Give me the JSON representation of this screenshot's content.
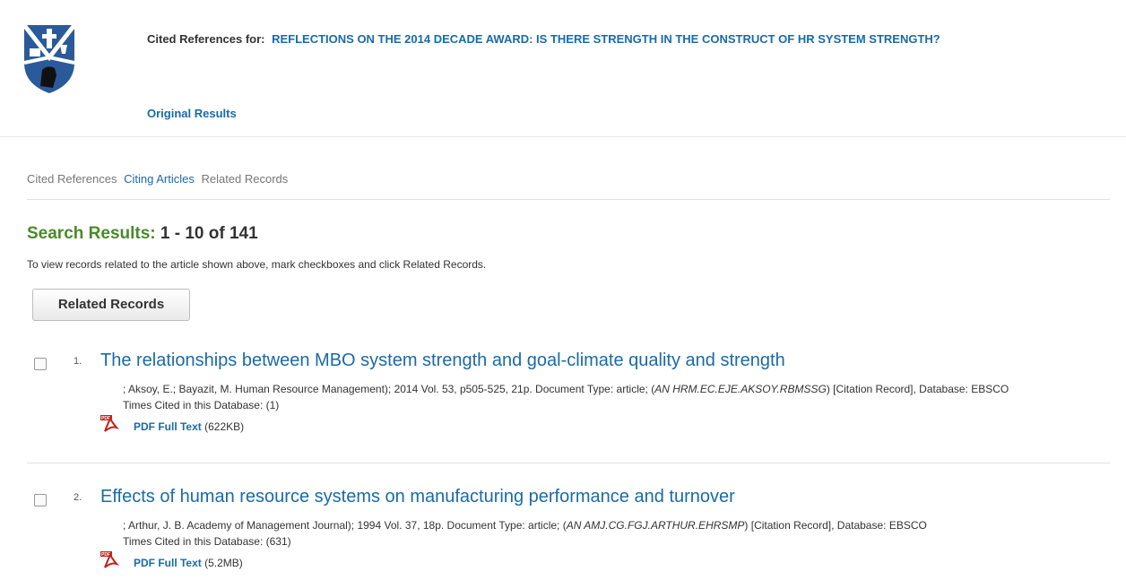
{
  "header": {
    "cited_prefix": "Cited References for:",
    "article_title": "REFLECTIONS ON THE 2014 DECADE AWARD: IS THERE STRENGTH IN THE CONSTRUCT OF HR SYSTEM STRENGTH?",
    "original_results": "Original Results",
    "logo_icon": "university-shield-logo-icon"
  },
  "tabs": [
    "Cited References",
    "Citing Articles",
    "Related Records"
  ],
  "results_header": {
    "label": "Search Results:",
    "range": "1 - 10 of 141",
    "instruction": "To view records related to the article shown above, mark checkboxes and click Related Records."
  },
  "related_records_button": "Related Records",
  "results": [
    {
      "number": "1.",
      "title": "The relationships between MBO system strength and goal-climate quality and strength",
      "meta_pre": "; Aksoy, E.; Bayazit, M. Human Resource Management); 2014 Vol. 53, p505-525, 21p. Document Type: article; (",
      "an": "AN HRM.EC.EJE.AKSOY.RBMSSG",
      "meta_post": ") [Citation Record], Database: EBSCO",
      "times_cited": "Times Cited in this Database: (1)",
      "pdf_label": "PDF Full Text",
      "pdf_size": "(622KB)"
    },
    {
      "number": "2.",
      "title": "Effects of human resource systems on manufacturing performance and turnover",
      "meta_pre": "; Arthur, J. B. Academy of Management Journal); 1994 Vol. 37, 18p. Document Type: article; (",
      "an": "AN AMJ.CG.FGJ.ARTHUR.EHRSMP",
      "meta_post": ") [Citation Record], Database: EBSCO",
      "times_cited": "Times Cited in this Database: (631)",
      "pdf_label": "PDF Full Text",
      "pdf_size": "(5.2MB)"
    }
  ],
  "colors": {
    "link": "#1a6aa8",
    "results_heading": "#4a8a2a",
    "logo_blue": "#2a5a9a",
    "pdf_red": "#c0251c"
  }
}
